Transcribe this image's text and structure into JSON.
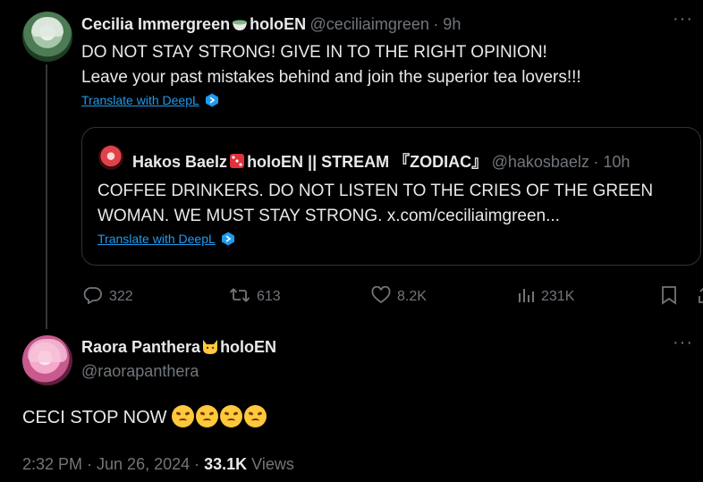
{
  "tweet1": {
    "display_name": "Cecilia Immergreen",
    "name_suffix": "holoEN",
    "name_emoji": "matcha-tea-emoji",
    "handle": "@ceciliaimgreen",
    "time": "· 9h",
    "text_line1": "DO NOT STAY STRONG! GIVE IN TO THE RIGHT OPINION!",
    "text_line2": "Leave your past mistakes behind and join the superior tea lovers!!!",
    "translate_label": "Translate with DeepL"
  },
  "quote": {
    "display_name": "Hakos Baelz",
    "name_emoji": "die-emoji",
    "name_suffix": "holoEN || STREAM 『ZODIAC』",
    "handle": "@hakosbaelz",
    "time": "· 10h",
    "text_line1": "COFFEE DRINKERS. DO NOT LISTEN TO THE CRIES OF THE GREEN",
    "text_line2": "WOMAN. WE MUST STAY STRONG. x.com/ceciliaimgreen...",
    "translate_label": "Translate with DeepL"
  },
  "actions": {
    "replies": "322",
    "reposts": "613",
    "likes": "8.2K",
    "views": "231K"
  },
  "tweet2": {
    "display_name": "Raora Panthera",
    "name_emoji": "cat-emoji",
    "name_suffix": "holoEN",
    "handle": "@raorapanthera",
    "text": "CECI STOP NOW",
    "text_emojis": [
      "pouting-cat-face",
      "pouting-cat-face",
      "pouting-cat-face",
      "pouting-cat-face"
    ],
    "timestamp": "2:32 PM · Jun 26, 2024 · ",
    "view_count": "33.1K",
    "views_label": " Views"
  },
  "colors": {
    "background": "#000000",
    "text": "#e7e9ea",
    "muted": "#71767b",
    "link": "#1d9bf0",
    "border": "#2f3336"
  }
}
